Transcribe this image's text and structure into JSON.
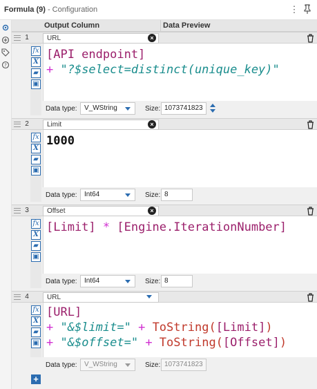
{
  "title": {
    "main": "Formula (9)",
    "sub": " - Configuration"
  },
  "header": {
    "output_column": "Output Column",
    "data_preview": "Data Preview"
  },
  "labels": {
    "data_type": "Data type:",
    "size": "Size:"
  },
  "rows": [
    {
      "num": "1",
      "name": "URL",
      "expr_lines": [
        [
          {
            "t": "[API endpoint]",
            "c": "field"
          }
        ],
        [
          {
            "t": "+ ",
            "c": "op"
          },
          {
            "t": "\"?$select=distinct(unique_key)\"",
            "c": "str"
          }
        ]
      ],
      "data_type": "V_WString",
      "size": "1073741823"
    },
    {
      "num": "2",
      "name": "Limit",
      "expr_lines": [
        [
          {
            "t": "1000",
            "c": "num"
          }
        ]
      ],
      "data_type": "Int64",
      "size": "8"
    },
    {
      "num": "3",
      "name": "Offset",
      "expr_lines": [
        [
          {
            "t": "[Limit]",
            "c": "field"
          },
          {
            "t": " * ",
            "c": "op"
          },
          {
            "t": "[Engine.IterationNumber]",
            "c": "field"
          }
        ]
      ],
      "data_type": "Int64",
      "size": "8"
    },
    {
      "num": "4",
      "name": "URL",
      "expr_lines": [
        [
          {
            "t": "[URL]",
            "c": "field"
          }
        ],
        [
          {
            "t": "+ ",
            "c": "op"
          },
          {
            "t": "\"&$limit=\"",
            "c": "str"
          },
          {
            "t": " + ",
            "c": "op"
          },
          {
            "t": "ToString(",
            "c": "fn"
          },
          {
            "t": "[Limit]",
            "c": "field"
          },
          {
            "t": ")",
            "c": "fn"
          }
        ],
        [
          {
            "t": "+ ",
            "c": "op"
          },
          {
            "t": "\"&$offset=\"",
            "c": "str"
          },
          {
            "t": " + ",
            "c": "op"
          },
          {
            "t": "ToString(",
            "c": "fn"
          },
          {
            "t": "[Offset]",
            "c": "field"
          },
          {
            "t": ")",
            "c": "fn"
          }
        ]
      ],
      "data_type": "V_WString",
      "size": "1073741823"
    }
  ],
  "icons": {
    "title_menu": "more-vertical-icon",
    "title_pin": "pin-icon",
    "sidebar": [
      "gear-icon",
      "plus-circle-icon",
      "tag-icon",
      "help-icon"
    ],
    "tools": [
      "fx-icon",
      "variable-x-icon",
      "open-folder-icon",
      "save-icon"
    ]
  },
  "colors": {
    "accent": "#2b6cb0",
    "field": "#9b1f6b",
    "operator": "#d12fd1",
    "string": "#1a8d8d",
    "function": "#c0392b"
  }
}
